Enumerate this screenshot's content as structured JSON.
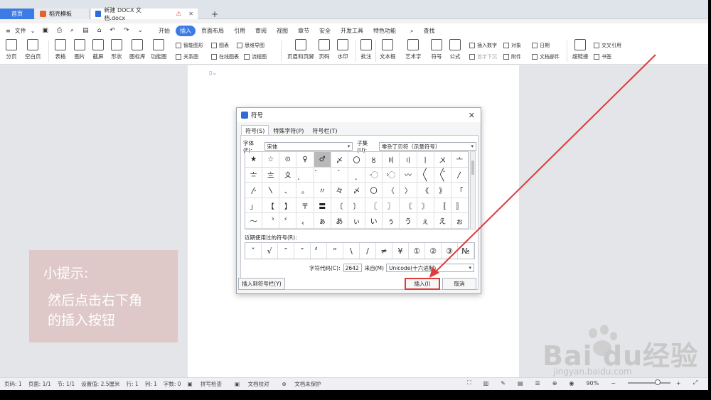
{
  "tabs": {
    "home": "首页",
    "tab2": "稻壳模板",
    "tab3": "新建 DOCX 文档.docx"
  },
  "menu": {
    "file": "文件",
    "items": [
      "开始",
      "插入",
      "页面布局",
      "引用",
      "审阅",
      "视图",
      "章节",
      "安全",
      "开发工具",
      "特色功能"
    ],
    "active": "插入",
    "search": "查找"
  },
  "ribbon": {
    "big": [
      "分页",
      "空白页",
      "表格",
      "图片",
      "截屏",
      "形状",
      "图标库",
      "功能图",
      "页眉和页脚",
      "页码",
      "水印",
      "批注",
      "文本框",
      "艺术字",
      "符号",
      "公式"
    ],
    "small": {
      "smartart": "智能图形",
      "chart": "图表",
      "mindmap": "思维导图",
      "relation": "关系图",
      "onlinechart": "在线图表",
      "flowchart": "流程图",
      "insert_number": "插入数字",
      "object": "对象",
      "date": "日期",
      "dropcap": "首字下沉",
      "attachment": "附件",
      "docparts": "文档部件",
      "hyperlink": "超链接",
      "bookmark": "书签",
      "crossref": "交叉引用"
    }
  },
  "dialog": {
    "title": "符号",
    "tabs": [
      "符号(S)",
      "特殊字符(P)",
      "符号栏(T)"
    ],
    "font_label": "字体(F):",
    "font_value": "宋体",
    "subset_label": "子集(U):",
    "subset_value": "零杂丁贝符（示意符号）",
    "grid": [
      [
        "★",
        "☆",
        "⊙",
        "♀",
        "♂",
        "〆",
        "〇",
        "〥",
        "〣",
        "〢",
        "〡",
        "〤",
        "〦"
      ],
      [
        "〧",
        "〨",
        "〩",
        "〪",
        "〫",
        "〬",
        "〭",
        "〮",
        "〯",
        "〰",
        "〱",
        "〲",
        "〳"
      ],
      [
        "〴",
        "〵",
        "、",
        "。",
        "〃",
        "々",
        "〆",
        "〇",
        "〈",
        "〉",
        "《",
        "》",
        "「"
      ],
      [
        "」",
        "【",
        "】",
        "〒",
        "〓",
        "〔",
        "〕",
        "〖",
        "〗",
        "〘",
        "〙",
        "〚",
        "〛"
      ],
      [
        "〜",
        "〝",
        "〞",
        "〟",
        "ぁ",
        "あ",
        "ぃ",
        "い",
        "ぅ",
        "う",
        "ぇ",
        "え",
        "ぉ"
      ]
    ],
    "recent_label": "近期使用过的符号(R):",
    "recent": [
      "ˇ",
      "√",
      "″",
      "″",
      "〞",
      "“",
      "\\",
      "/",
      "≠",
      "¥",
      "①",
      "②",
      "③",
      "№",
      "√"
    ],
    "code_label": "字符代码(C):",
    "code_value": "2642",
    "from_label": "来自(M)",
    "from_value": "Unicode(十六进制)",
    "btn_insert_to_bar": "插入到符号栏(Y)",
    "btn_insert": "插入(I)",
    "btn_cancel": "取消"
  },
  "tip": {
    "title": "小提示:",
    "line1": "然后点击右下角",
    "line2": "的插入按钮"
  },
  "watermark": {
    "brand": "Bai du经验",
    "url": "jingyan.baidu.com"
  },
  "status": {
    "page": "页码: 1",
    "pages": "页面: 1/1",
    "section": "节: 1/1",
    "settings": "设置值: 2.5厘米",
    "row": "行: 1",
    "col": "列: 1",
    "words": "字数: 0",
    "spell": "拼写检查",
    "proof": "文档校对",
    "protect": "文档未保护",
    "zoom": "90%"
  },
  "colors": {
    "accent": "#3c7be5",
    "highlight_red": "#e03a3a",
    "tip_bg": "#dec9c8"
  }
}
